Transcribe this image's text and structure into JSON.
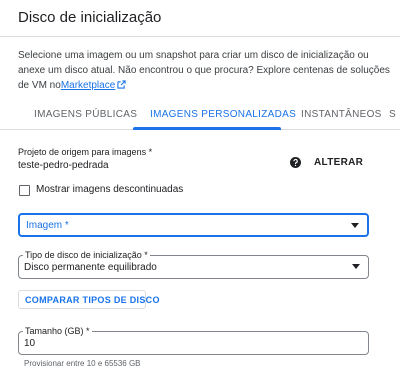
{
  "dialog": {
    "title": "Disco de inicialização"
  },
  "description": {
    "text": "Selecione uma imagem ou um snapshot para criar um disco de inicialização ou anexe um disco atual. Não encontrou o que procura? Explore centenas de soluções de VM no",
    "link": "Marketplace",
    "link_icon": "external-link-icon"
  },
  "tabs": [
    {
      "label": "IMAGENS PÚBLICAS",
      "active": false
    },
    {
      "label": "IMAGENS PERSONALIZADAS",
      "active": true
    },
    {
      "label": "INSTANTÂNEOS",
      "active": false
    },
    {
      "label": "S",
      "active": false
    }
  ],
  "project": {
    "label": "Projeto de origem para imagens *",
    "value": "teste-pedro-pedrada",
    "help_icon": "help-icon",
    "change_button": "ALTERAR"
  },
  "show_deprecated": {
    "label": "Mostrar imagens descontinuadas",
    "checked": false
  },
  "image_field": {
    "placeholder": "Imagem *"
  },
  "disk_type": {
    "label": "Tipo de disco de inicialização *",
    "value": "Disco permanente equilibrado"
  },
  "compare_button": "COMPARAR TIPOS DE DISCO",
  "size": {
    "label": "Tamanho (GB) *",
    "value": "10",
    "hint": "Provisionar entre 10 e 65536 GB"
  },
  "colors": {
    "accent": "#1a73e8",
    "text": "#202124",
    "border": "#dadce0"
  }
}
